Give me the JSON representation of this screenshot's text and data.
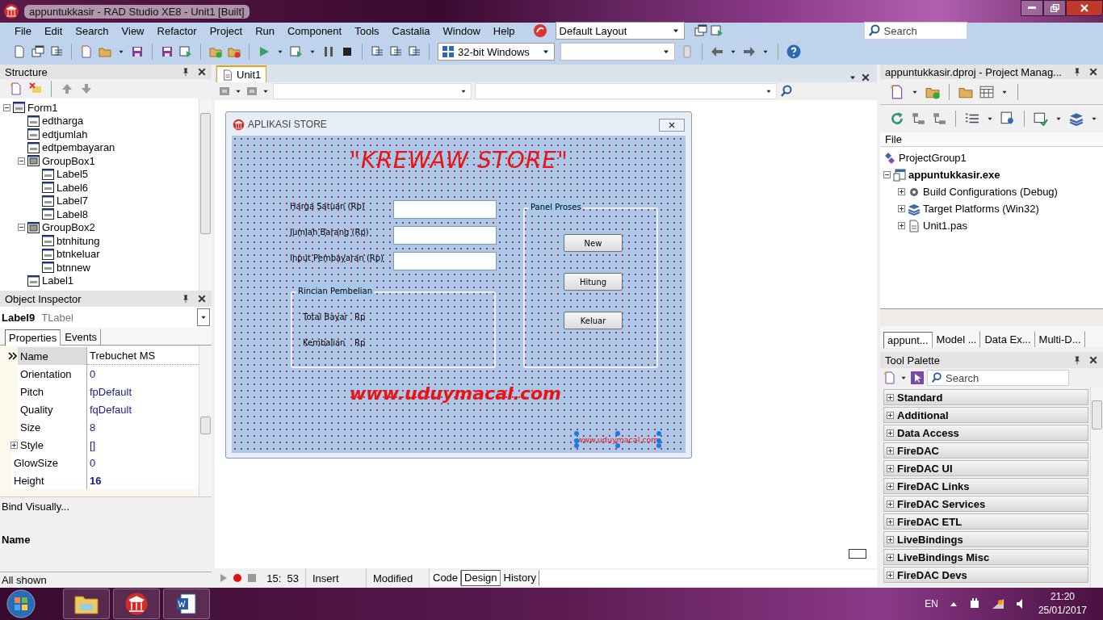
{
  "window": {
    "title": "appuntukkasir - RAD Studio XE8 - Unit1 [Built]"
  },
  "menu": [
    {
      "label": "File"
    },
    {
      "label": "Edit"
    },
    {
      "label": "Search"
    },
    {
      "label": "View"
    },
    {
      "label": "Refactor"
    },
    {
      "label": "Project"
    },
    {
      "label": "Run"
    },
    {
      "label": "Component"
    },
    {
      "label": "Tools"
    },
    {
      "label": "Castalia"
    },
    {
      "label": "Window"
    },
    {
      "label": "Help"
    }
  ],
  "toolbar": {
    "layout": "Default Layout",
    "platform": "32-bit Windows",
    "search_placeholder": "Search"
  },
  "structure": {
    "title": "Structure",
    "tree": [
      {
        "label": "Form1",
        "expanded": true,
        "children": [
          {
            "label": "edtharga"
          },
          {
            "label": "edtjumlah"
          },
          {
            "label": "edtpembayaran"
          },
          {
            "label": "GroupBox1",
            "expanded": true,
            "children": [
              {
                "label": "Label5"
              },
              {
                "label": "Label6"
              },
              {
                "label": "Label7"
              },
              {
                "label": "Label8"
              }
            ]
          },
          {
            "label": "GroupBox2",
            "expanded": true,
            "children": [
              {
                "label": "btnhitung"
              },
              {
                "label": "btnkeluar"
              },
              {
                "label": "btnnew"
              }
            ]
          },
          {
            "label": "Label1"
          }
        ]
      }
    ]
  },
  "object_inspector": {
    "title": "Object Inspector",
    "object_name": "Label9",
    "object_type": "TLabel",
    "tabs": [
      {
        "label": "Properties",
        "selected": true
      },
      {
        "label": "Events",
        "selected": false
      }
    ],
    "font_sub_properties": [
      {
        "name": "Name",
        "value": "Trebuchet MS",
        "selected": true,
        "modified": false
      },
      {
        "name": "Orientation",
        "value": "0",
        "selected": false,
        "modified": false
      },
      {
        "name": "Pitch",
        "value": "fpDefault",
        "selected": false,
        "modified": false
      },
      {
        "name": "Quality",
        "value": "fqDefault",
        "selected": false,
        "modified": false
      },
      {
        "name": "Size",
        "value": "8",
        "selected": false,
        "modified": false
      },
      {
        "name": "Style",
        "value": "[]",
        "selected": false,
        "modified": false,
        "expanded": false
      }
    ],
    "properties": [
      {
        "name": "GlowSize",
        "value": "0",
        "selected": false,
        "modified": false
      },
      {
        "name": "Height",
        "value": "16",
        "selected": false,
        "modified": true
      }
    ],
    "bind_link": "Bind Visually...",
    "description_title": "Name",
    "filter_status": "All shown"
  },
  "editor": {
    "tabs": [
      {
        "label": "Unit1",
        "selected": true
      }
    ],
    "status": {
      "position": "15:  53",
      "mode": "Insert",
      "state": "Modified"
    },
    "view_tabs": [
      {
        "label": "Code",
        "selected": false
      },
      {
        "label": "Design",
        "selected": true
      },
      {
        "label": "History",
        "selected": false
      }
    ]
  },
  "form": {
    "title": "APLIKASI STORE",
    "heading": "\"KREWAW STORE\"",
    "fields": [
      {
        "label": "Harga Satuan (Rp)"
      },
      {
        "label": "Jumlah Barang (Rp)"
      },
      {
        "label": "Input Pembayaran (Rp)"
      }
    ],
    "summary_group": {
      "caption": "Rincian Pembelian",
      "rows": [
        {
          "label": "Total Bayar",
          "unit": "Rp"
        },
        {
          "label": "Kembalian",
          "unit": "Rp"
        }
      ]
    },
    "process_group": {
      "caption": "Panel Proses",
      "buttons": [
        {
          "label": "New"
        },
        {
          "label": "Hitung"
        },
        {
          "label": "Keluar"
        }
      ]
    },
    "website": "www.uduymacal.com",
    "small_label": {
      "text": "www.uduymacal.com",
      "selected": true
    }
  },
  "project_manager": {
    "title": "appuntukkasir.dproj - Project Manag...",
    "column": "File",
    "tree": [
      {
        "label": "ProjectGroup1",
        "kind": "group",
        "children": [
          {
            "label": "appuntukkasir.exe",
            "kind": "project",
            "expanded": true,
            "children": [
              {
                "label": "Build Configurations (Debug)",
                "kind": "config",
                "expanded": false
              },
              {
                "label": "Target Platforms (Win32)",
                "kind": "platform",
                "expanded": false
              },
              {
                "label": "Unit1.pas",
                "kind": "unit",
                "expanded": false
              }
            ]
          }
        ]
      }
    ],
    "tabs": [
      {
        "label": "appunt...",
        "selected": true
      },
      {
        "label": "Model ...",
        "selected": false
      },
      {
        "label": "Data Ex...",
        "selected": false
      },
      {
        "label": "Multi-D...",
        "selected": false
      }
    ]
  },
  "tool_palette": {
    "title": "Tool Palette",
    "search_placeholder": "Search",
    "categories": [
      {
        "label": "Standard",
        "expanded": false
      },
      {
        "label": "Additional",
        "expanded": false
      },
      {
        "label": "Data Access",
        "expanded": false
      },
      {
        "label": "FireDAC",
        "expanded": false
      },
      {
        "label": "FireDAC UI",
        "expanded": false
      },
      {
        "label": "FireDAC Links",
        "expanded": false
      },
      {
        "label": "FireDAC Services",
        "expanded": false
      },
      {
        "label": "FireDAC ETL",
        "expanded": false
      },
      {
        "label": "LiveBindings",
        "expanded": false
      },
      {
        "label": "LiveBindings Misc",
        "expanded": false
      },
      {
        "label": "FireDAC Devs",
        "expanded": false
      }
    ]
  },
  "taskbar": {
    "language": "EN",
    "time": "21:20",
    "date": "25/01/2017"
  }
}
